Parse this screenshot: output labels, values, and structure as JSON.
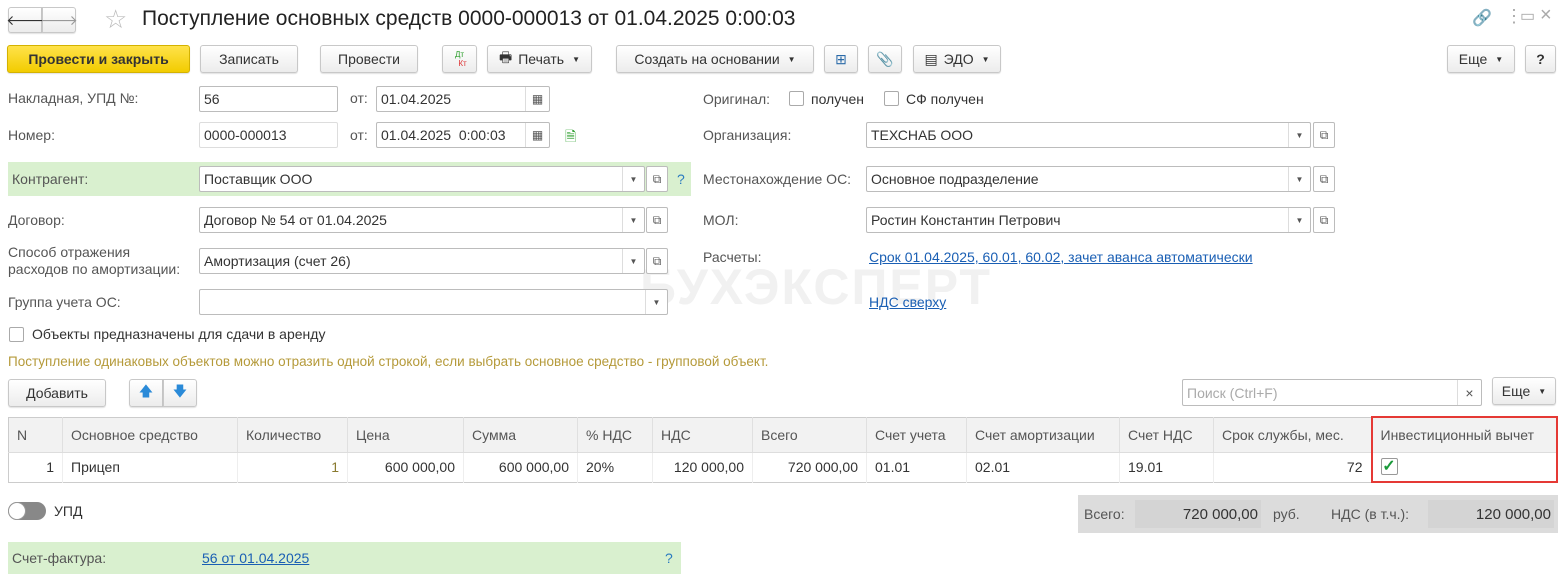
{
  "title": "Поступление основных средств 0000-000013 от 01.04.2025 0:00:03",
  "watermark": "БУХЭКСПЕРТ",
  "toolbar": {
    "post_close": "Провести и закрыть",
    "save": "Записать",
    "post": "Провести",
    "dtkt_dt": "Дт",
    "dtkt_kt": "Кт",
    "print": "Печать",
    "create_based": "Создать на основании",
    "edo": "ЭДО",
    "more": "Еще",
    "help": "?"
  },
  "form": {
    "invoice_label": "Накладная, УПД №:",
    "invoice_value": "56",
    "from_label": "от:",
    "invoice_date": "01.04.2025",
    "number_label": "Номер:",
    "number_value": "0000-000013",
    "number_date": "01.04.2025  0:00:03",
    "counterparty_label": "Контрагент:",
    "counterparty_value": "Поставщик ООО",
    "help": "?",
    "contract_label": "Договор:",
    "contract_value": "Договор № 54 от 01.04.2025",
    "amort_label_1": "Способ отражения",
    "amort_label_2": "расходов по амортизации:",
    "amort_value": "Амортизация (счет 26)",
    "group_label": "Группа учета ОС:",
    "group_value": "",
    "rent_label": "Объекты предназначены для сдачи в аренду",
    "original_label": "Оригинал:",
    "received": "получен",
    "sf_received": "СФ получен",
    "org_label": "Организация:",
    "org_value": "ТЕХСНАБ ООО",
    "location_label": "Местонахождение ОС:",
    "location_value": "Основное подразделение",
    "mol_label": "МОЛ:",
    "mol_value": "Ростин Константин Петрович",
    "settlements_label": "Расчеты:",
    "settlements_link": "Срок 01.04.2025, 60.01, 60.02, зачет аванса автоматически",
    "vat_link": "НДС сверху",
    "hint": "Поступление одинаковых объектов можно отразить одной строкой, если выбрать основное средство - групповой объект."
  },
  "table_toolbar": {
    "add": "Добавить",
    "search_placeholder": "Поиск (Ctrl+F)",
    "clear": "×",
    "more": "Еще"
  },
  "table": {
    "columns": [
      "N",
      "Основное средство",
      "Количество",
      "Цена",
      "Сумма",
      "% НДС",
      "НДС",
      "Всего",
      "Счет учета",
      "Счет амортизации",
      "Счет НДС",
      "Срок службы, мес.",
      "Инвестиционный вычет"
    ],
    "rows": [
      {
        "n": "1",
        "asset": "Прицеп",
        "qty": "1",
        "price": "600 000,00",
        "sum": "600 000,00",
        "vat_rate": "20%",
        "vat": "120 000,00",
        "total": "720 000,00",
        "account": "01.01",
        "amort_account": "02.01",
        "vat_account": "19.01",
        "life": "72",
        "investment_deduction": true
      }
    ]
  },
  "footer": {
    "upd_label": "УПД",
    "total_label": "Всего:",
    "total_value": "720 000,00",
    "currency": "руб.",
    "vat_label": "НДС (в т.ч.):",
    "vat_value": "120 000,00",
    "sf_label": "Счет-фактура:",
    "sf_link": "56 от 01.04.2025",
    "sf_help": "?"
  },
  "colors": {
    "accent": "#f2cc00",
    "highlight": "#e53935",
    "green_bg": "#d9f0cf",
    "link": "#1a5fb4"
  }
}
